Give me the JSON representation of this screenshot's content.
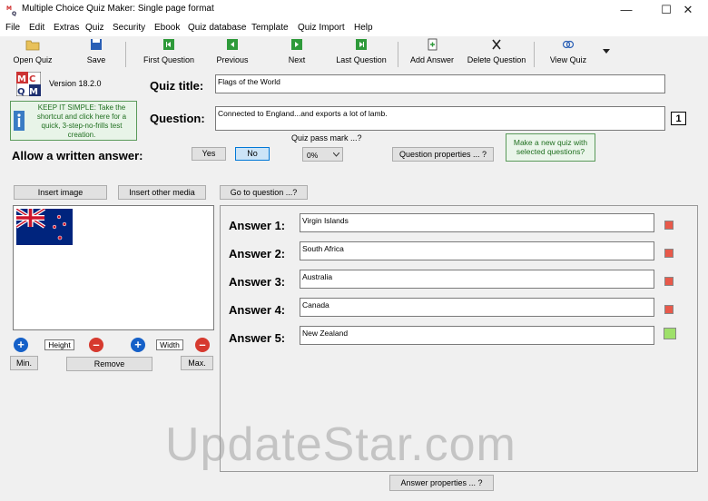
{
  "window": {
    "title": "Multiple Choice Quiz Maker: Single page format",
    "minimize_glyph": "—",
    "maximize_glyph": "☐",
    "close_glyph": "✕"
  },
  "menu": [
    "File",
    "Edit",
    "Extras",
    "Quiz",
    "Security",
    "Ebook",
    "Quiz database",
    "Template",
    "Quiz Import",
    "Help"
  ],
  "toolbar": {
    "open_quiz": "Open Quiz",
    "save": "Save",
    "first_question": "First Question",
    "previous": "Previous",
    "next": "Next",
    "last_question": "Last Question",
    "add_answer": "Add Answer",
    "delete_question": "Delete Question",
    "view_quiz": "View Quiz"
  },
  "logo": {
    "text": "MC QM"
  },
  "version": "Version 18.2.0",
  "keep_simple": "KEEP IT SIMPLE: Take the shortcut and click here for a quick, 3-step-no-frills test creation.",
  "quiz_title_label": "Quiz title:",
  "quiz_title_value": "Flags of the World",
  "question_label": "Question:",
  "question_value": "Connected to England...and exports a lot of lamb.",
  "question_number": "1",
  "allow_written_answer": "Allow a written answer:",
  "yes": "Yes",
  "no": "No",
  "pass_mark_label": "Quiz pass mark ...?",
  "pass_mark_value": "0%",
  "question_properties": "Question properties ... ?",
  "make_new_quiz": "Make a new quiz with selected questions?",
  "insert_image": "Insert image",
  "insert_other_media": "Insert other media",
  "go_to_question": "Go to question ...?",
  "image_controls": {
    "height": "Height",
    "width": "Width",
    "min": "Min.",
    "remove": "Remove",
    "max": "Max."
  },
  "answers": [
    {
      "label": "Answer 1:",
      "value": "Virgin Islands",
      "color": "#e8594a"
    },
    {
      "label": "Answer 2:",
      "value": "South Africa",
      "color": "#e8594a"
    },
    {
      "label": "Answer 3:",
      "value": "Australia",
      "color": "#e8594a"
    },
    {
      "label": "Answer 4:",
      "value": "Canada",
      "color": "#e8594a"
    },
    {
      "label": "Answer 5:",
      "value": "New Zealand",
      "color": "#9ee06a"
    }
  ],
  "answer_properties": "Answer properties ... ?",
  "watermark": "UpdateStar.com"
}
